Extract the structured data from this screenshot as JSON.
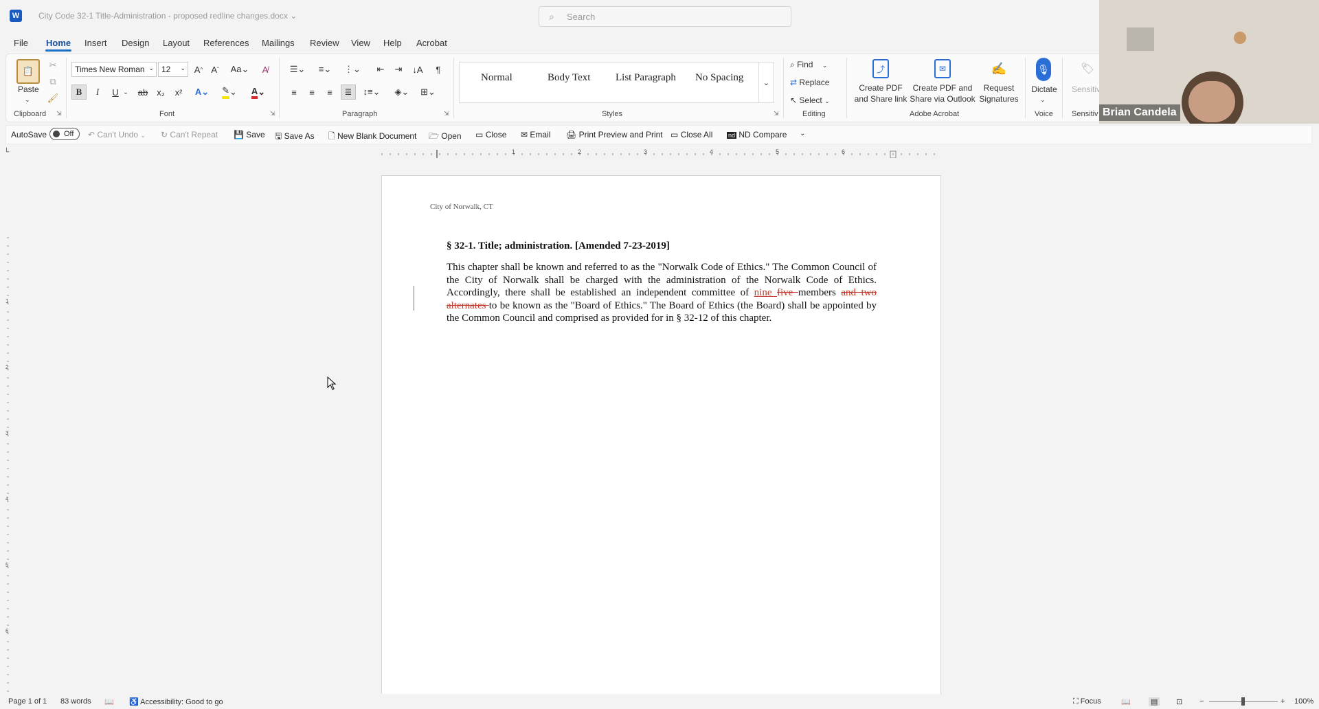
{
  "titlebar": {
    "doc_title": "City Code 32-1 Title-Administration - proposed redline changes.docx",
    "search_placeholder": "Search",
    "app_logo": "W"
  },
  "menu": [
    "File",
    "Home",
    "Insert",
    "Design",
    "Layout",
    "References",
    "Mailings",
    "Review",
    "View",
    "Help",
    "Acrobat"
  ],
  "ribbon": {
    "clipboard": {
      "paste": "Paste",
      "group": "Clipboard"
    },
    "font": {
      "name": "Times New Roman",
      "size": "12",
      "group": "Font"
    },
    "paragraph": {
      "group": "Paragraph"
    },
    "styles": {
      "items": [
        "Normal",
        "Body Text",
        "List Paragraph",
        "No Spacing"
      ],
      "group": "Styles"
    },
    "editing": {
      "find": "Find",
      "replace": "Replace",
      "select": "Select",
      "group": "Editing"
    },
    "acrobat": {
      "create_pdf": [
        "Create PDF",
        "and Share link"
      ],
      "create_outlook": [
        "Create PDF and",
        "Share via Outlook"
      ],
      "request_sig": [
        "Request",
        "Signatures"
      ],
      "group": "Adobe Acrobat"
    },
    "voice": {
      "dictate": "Dictate",
      "group": "Voice"
    },
    "sensitivity": {
      "label": "Sensitiv",
      "group": "Sensitiv"
    }
  },
  "qat": {
    "autosave": "AutoSave",
    "toggle": "Off",
    "undo": "Can't Undo",
    "repeat": "Can't Repeat",
    "save": "Save",
    "save_as": "Save As",
    "new_blank": "New Blank Document",
    "open": "Open",
    "close": "Close",
    "email": "Email",
    "print_preview": "Print Preview and Print",
    "close_all": "Close All",
    "nd_compare": "ND Compare"
  },
  "ruler_numbers": [
    "1",
    "2",
    "3",
    "4",
    "5",
    "6"
  ],
  "vruler_numbers": [
    "1",
    "2",
    "3",
    "4",
    "5",
    "6"
  ],
  "document": {
    "header": "City of Norwalk, CT",
    "heading": "§ 32-1.  Title; administration. [Amended 7-23-2019]",
    "p1": "This chapter shall be known and referred to as the \"Norwalk Code of Ethics.\" The Common Council of the City of Norwalk shall be charged with the administration of the Norwalk Code of Ethics. Accordingly, there shall be established an independent committee of ",
    "ins1": "nine",
    "sp": " ",
    "del1": "five ",
    "p2": "members ",
    "del2": "and two alternates ",
    "p3": "to be known as the \"Board of Ethics.\" The Board of Ethics (the Board) shall be appointed by the Common Council and comprised as provided for in § 32-12 of this chapter."
  },
  "status": {
    "page": "Page 1 of 1",
    "words": "83 words",
    "accessibility": "Accessibility: Good to go",
    "focus": "Focus",
    "zoom": "100%"
  },
  "video": {
    "name": "Brian Candela"
  },
  "colors": {
    "accent": "#185abd",
    "redline": "#c0392b"
  }
}
